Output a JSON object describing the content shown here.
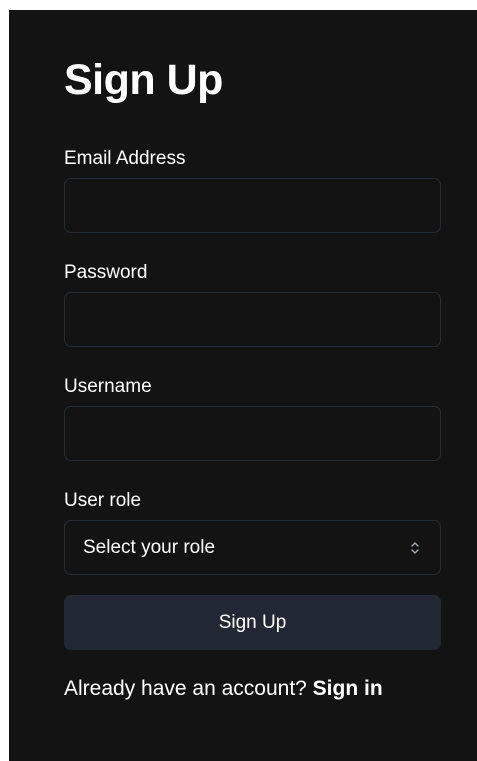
{
  "form": {
    "title": "Sign Up",
    "email": {
      "label": "Email Address",
      "value": "",
      "placeholder": ""
    },
    "password": {
      "label": "Password",
      "value": "",
      "placeholder": ""
    },
    "username": {
      "label": "Username",
      "value": "",
      "placeholder": ""
    },
    "role": {
      "label": "User role",
      "selected": "Select your role",
      "icon": "chevron-up-down-icon"
    },
    "submit_label": "Sign Up",
    "footer": {
      "text": "Already have an account? ",
      "link_label": "Sign in"
    }
  },
  "colors": {
    "background": "#131313",
    "input_border": "#262c36",
    "button_bg": "#222833",
    "text": "#ffffff"
  }
}
